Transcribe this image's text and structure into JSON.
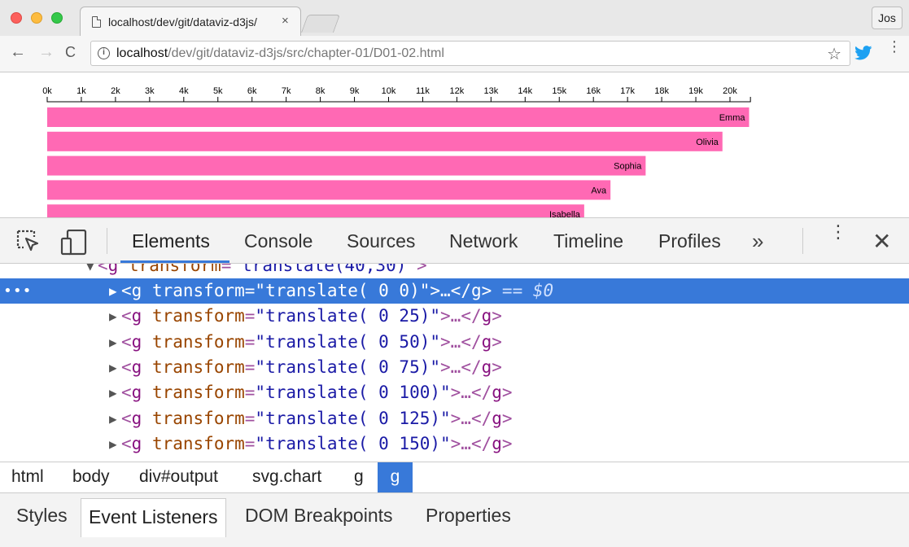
{
  "browser": {
    "tab_title": "localhost/dev/git/dataviz-d3js/",
    "tab_close": "×",
    "profile_label": "Jos",
    "url_host": "localhost",
    "url_path": "/dev/git/dataviz-d3js/src/chapter-01/D01-02.html",
    "back_glyph": "←",
    "forward_glyph": "→",
    "reload_glyph": "C",
    "star_glyph": "☆",
    "menu_glyph": "⋮",
    "info_glyph": "i"
  },
  "chart_data": {
    "type": "bar",
    "orientation": "horizontal",
    "color": "#ff69b4",
    "x_ticks": [
      "0k",
      "1k",
      "2k",
      "3k",
      "4k",
      "5k",
      "6k",
      "7k",
      "8k",
      "9k",
      "10k",
      "11k",
      "12k",
      "13k",
      "14k",
      "15k",
      "16k",
      "17k",
      "18k",
      "19k",
      "20k"
    ],
    "xlim": [
      0,
      20600
    ],
    "categories": [
      "Emma",
      "Olivia",
      "Sophia",
      "Ava",
      "Isabella"
    ],
    "values": [
      20560,
      19780,
      17530,
      16500,
      15730
    ],
    "xlabel": "",
    "ylabel": "",
    "title": ""
  },
  "devtools": {
    "tabs": [
      {
        "label": "Elements"
      },
      {
        "label": "Console"
      },
      {
        "label": "Sources"
      },
      {
        "label": "Network"
      },
      {
        "label": "Timeline"
      },
      {
        "label": "Profiles"
      }
    ],
    "more_glyph": "»",
    "kebab_glyph": "⋮",
    "close_glyph": "✕",
    "tree": {
      "parent": {
        "tag": "g",
        "attr": "transform",
        "value": "\"translate(40,30)\""
      },
      "children": [
        {
          "value": "\"translate( 0 0)\""
        },
        {
          "value": "\"translate( 0 25)\""
        },
        {
          "value": "\"translate( 0 50)\""
        },
        {
          "value": "\"translate( 0 75)\""
        },
        {
          "value": "\"translate( 0 100)\""
        },
        {
          "value": "\"translate( 0 125)\""
        },
        {
          "value": "\"translate( 0 150)\""
        }
      ],
      "child_tag": "g",
      "child_attr": "transform",
      "ellipsis": "…",
      "selected_suffix": " == $0",
      "selected_dots": "•••"
    },
    "breadcrumbs": [
      "html",
      "body",
      "div#output",
      "svg.chart",
      "g",
      "g"
    ],
    "sidebar_tabs": [
      "Styles",
      "Event Listeners",
      "DOM Breakpoints",
      "Properties"
    ]
  },
  "colors": {
    "accent": "#3879d9",
    "bar": "#ff69b4",
    "twitter": "#1da1f2"
  }
}
